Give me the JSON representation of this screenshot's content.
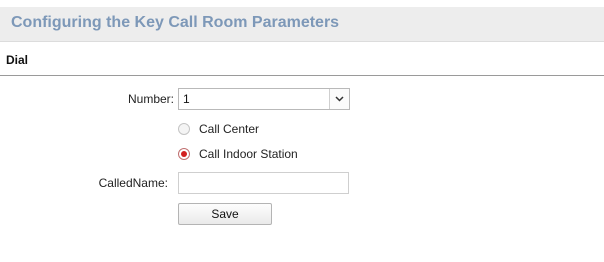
{
  "header": {
    "title": "Configuring the Key Call Room Parameters"
  },
  "section": {
    "label": "Dial"
  },
  "form": {
    "number": {
      "label": "Number:",
      "selected_value": "1",
      "arrow_icon": "chevron-down-icon"
    },
    "call_target": {
      "options": [
        {
          "label": "Call Center",
          "checked": false
        },
        {
          "label": "Call Indoor Station",
          "checked": true
        }
      ]
    },
    "called_name": {
      "label": "CalledName:",
      "value": ""
    },
    "save_label": "Save"
  },
  "colors": {
    "title_text": "#7d98b8",
    "title_bar_bg": "#ededed",
    "radio_selected": "#d21f1f"
  }
}
